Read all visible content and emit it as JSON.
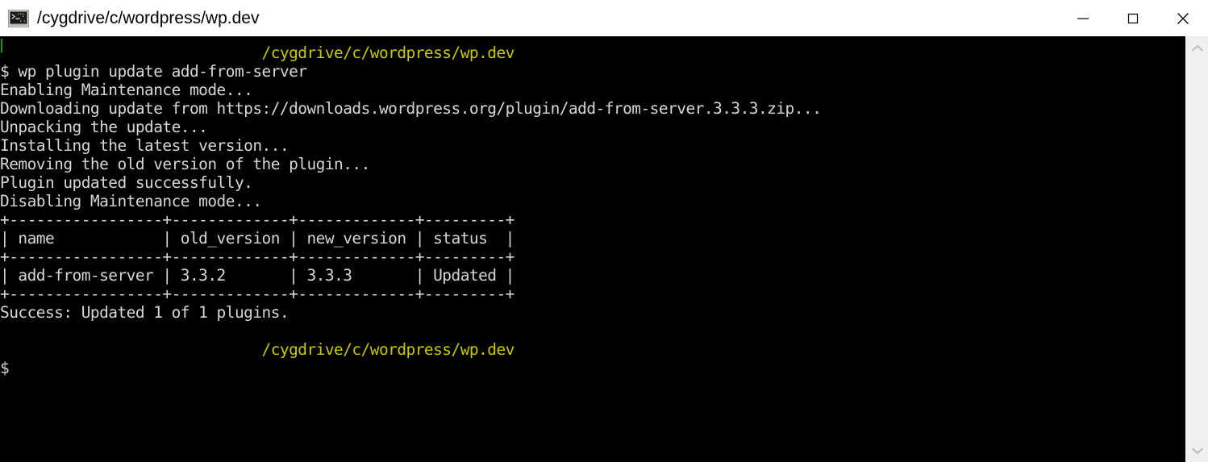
{
  "window": {
    "title": "/cygdrive/c/wordpress/wp.dev",
    "icon": "terminal-icon",
    "controls": {
      "minimize_label": "—",
      "maximize_label": "□",
      "close_label": "✕"
    }
  },
  "colors": {
    "background": "#000000",
    "foreground": "#d6d6d6",
    "prompt_path": "#c8c800",
    "cursor_mark": "#15a015",
    "titlebar_bg": "#ffffff",
    "titlebar_fg": "#000000",
    "scrollbar_track": "#f0f0f0",
    "scrollbar_arrow": "#c8c8c8"
  },
  "terminal": {
    "prompt_symbol": "$",
    "lines": [
      {
        "id": "prompt-path-1",
        "color": "yellow",
        "text": "                             /cygdrive/c/wordpress/wp.dev"
      },
      {
        "id": "command-1",
        "color": "white",
        "text": "$ wp plugin update add-from-server"
      },
      {
        "id": "output-enabling-maintenance",
        "color": "white",
        "text": "Enabling Maintenance mode..."
      },
      {
        "id": "output-downloading-update",
        "color": "white",
        "text": "Downloading update from https://downloads.wordpress.org/plugin/add-from-server.3.3.3.zip..."
      },
      {
        "id": "output-unpacking",
        "color": "white",
        "text": "Unpacking the update..."
      },
      {
        "id": "output-installing",
        "color": "white",
        "text": "Installing the latest version..."
      },
      {
        "id": "output-removing-old",
        "color": "white",
        "text": "Removing the old version of the plugin..."
      },
      {
        "id": "output-plugin-updated",
        "color": "white",
        "text": "Plugin updated successfully."
      },
      {
        "id": "output-disabling-maintenance",
        "color": "white",
        "text": "Disabling Maintenance mode..."
      },
      {
        "id": "table-top-border",
        "color": "white",
        "text": "+-----------------+-------------+-------------+---------+"
      },
      {
        "id": "table-header-row",
        "color": "white",
        "text": "| name            | old_version | new_version | status  |"
      },
      {
        "id": "table-header-separator",
        "color": "white",
        "text": "+-----------------+-------------+-------------+---------+"
      },
      {
        "id": "table-data-row-1",
        "color": "white",
        "text": "| add-from-server | 3.3.2       | 3.3.3       | Updated |"
      },
      {
        "id": "table-bottom-border",
        "color": "white",
        "text": "+-----------------+-------------+-------------+---------+"
      },
      {
        "id": "output-success",
        "color": "white",
        "text": "Success: Updated 1 of 1 plugins."
      },
      {
        "id": "blank-1",
        "color": "white",
        "text": ""
      },
      {
        "id": "prompt-path-2",
        "color": "yellow",
        "text": "                             /cygdrive/c/wordpress/wp.dev"
      },
      {
        "id": "prompt-2",
        "color": "white",
        "text": "$"
      }
    ],
    "command_table": {
      "columns": [
        "name",
        "old_version",
        "new_version",
        "status"
      ],
      "rows": [
        [
          "add-from-server",
          "3.3.2",
          "3.3.3",
          "Updated"
        ]
      ]
    },
    "summary": "Success: Updated 1 of 1 plugins.",
    "download_url": "https://downloads.wordpress.org/plugin/add-from-server.3.3.3.zip"
  },
  "scrollbar": {
    "up_arrow": "chevron-up-icon",
    "down_arrow": "chevron-down-icon"
  }
}
